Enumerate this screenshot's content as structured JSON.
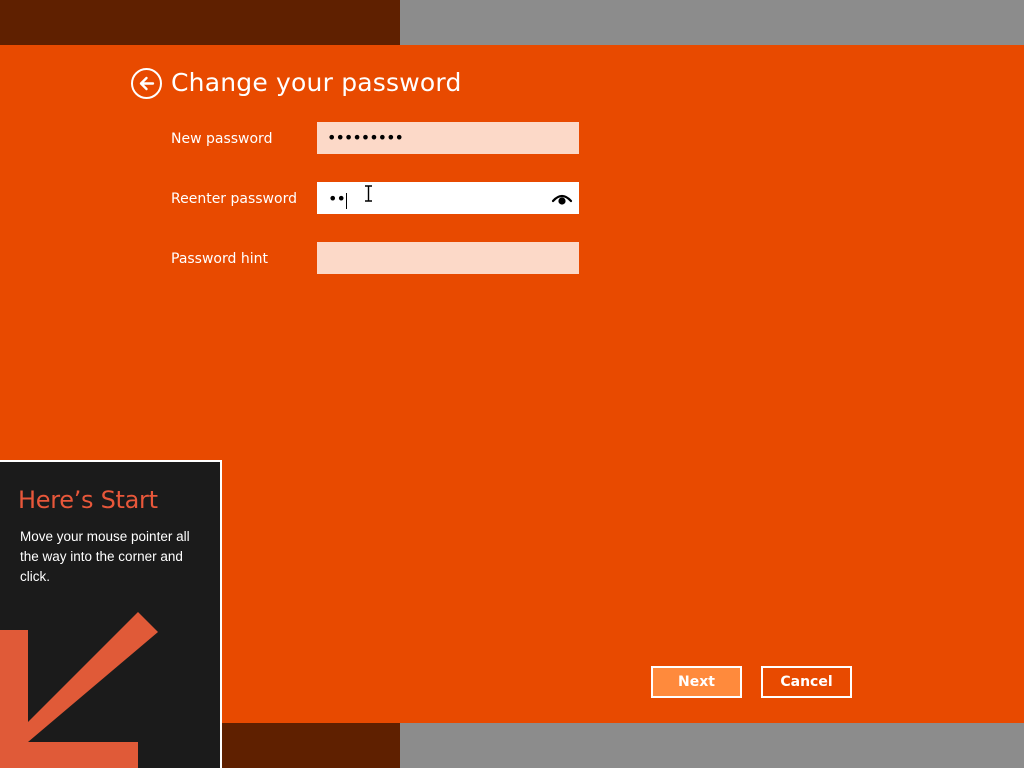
{
  "page": {
    "title": "Change your password",
    "back_icon": "back-arrow-icon"
  },
  "form": {
    "new_password": {
      "label": "New password",
      "value": "•••••••••"
    },
    "reenter_password": {
      "label": "Reenter password",
      "value": "••",
      "reveal_icon": "eye-icon"
    },
    "password_hint": {
      "label": "Password hint",
      "value": ""
    }
  },
  "buttons": {
    "next": "Next",
    "cancel": "Cancel"
  },
  "tip": {
    "title": "Here’s Start",
    "body": "Move your mouse pointer all the way into the corner and click.",
    "arrow_icon": "down-left-arrow-icon"
  },
  "colors": {
    "accent": "#e84a00",
    "next_button": "#ff8a3c",
    "input_inactive": "#fcd9c8",
    "tip_background": "#1b1b1b",
    "tip_title": "#e8573a",
    "band_dark": "#5f2000",
    "band_gray": "#8c8c8c"
  }
}
